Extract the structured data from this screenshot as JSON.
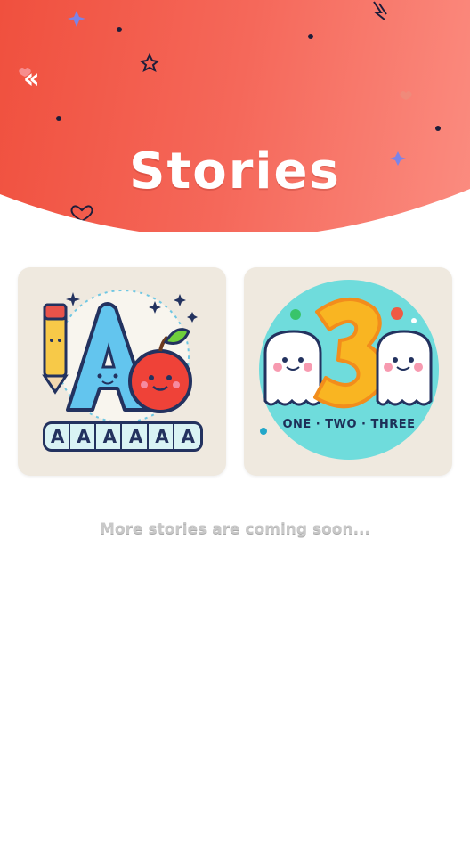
{
  "header": {
    "title": "Stories",
    "back_icon": "chevrons-left-icon",
    "background_colors": [
      "#f0503e",
      "#fb8c80"
    ]
  },
  "stories": [
    {
      "name": "alphabet-story",
      "letters": [
        "A",
        "A",
        "A",
        "A",
        "A",
        "A"
      ],
      "icon": "letter-a-apple-pencil-illustration"
    },
    {
      "name": "numbers-story",
      "label": "ONE · TWO · THREE",
      "icon": "number-three-ghosts-illustration"
    }
  ],
  "footer": {
    "coming_soon": "More stories are coming soon..."
  },
  "colors": {
    "accent": "#f0503e",
    "card_background": "#efe9df",
    "muted_text": "#c9c9c9"
  }
}
